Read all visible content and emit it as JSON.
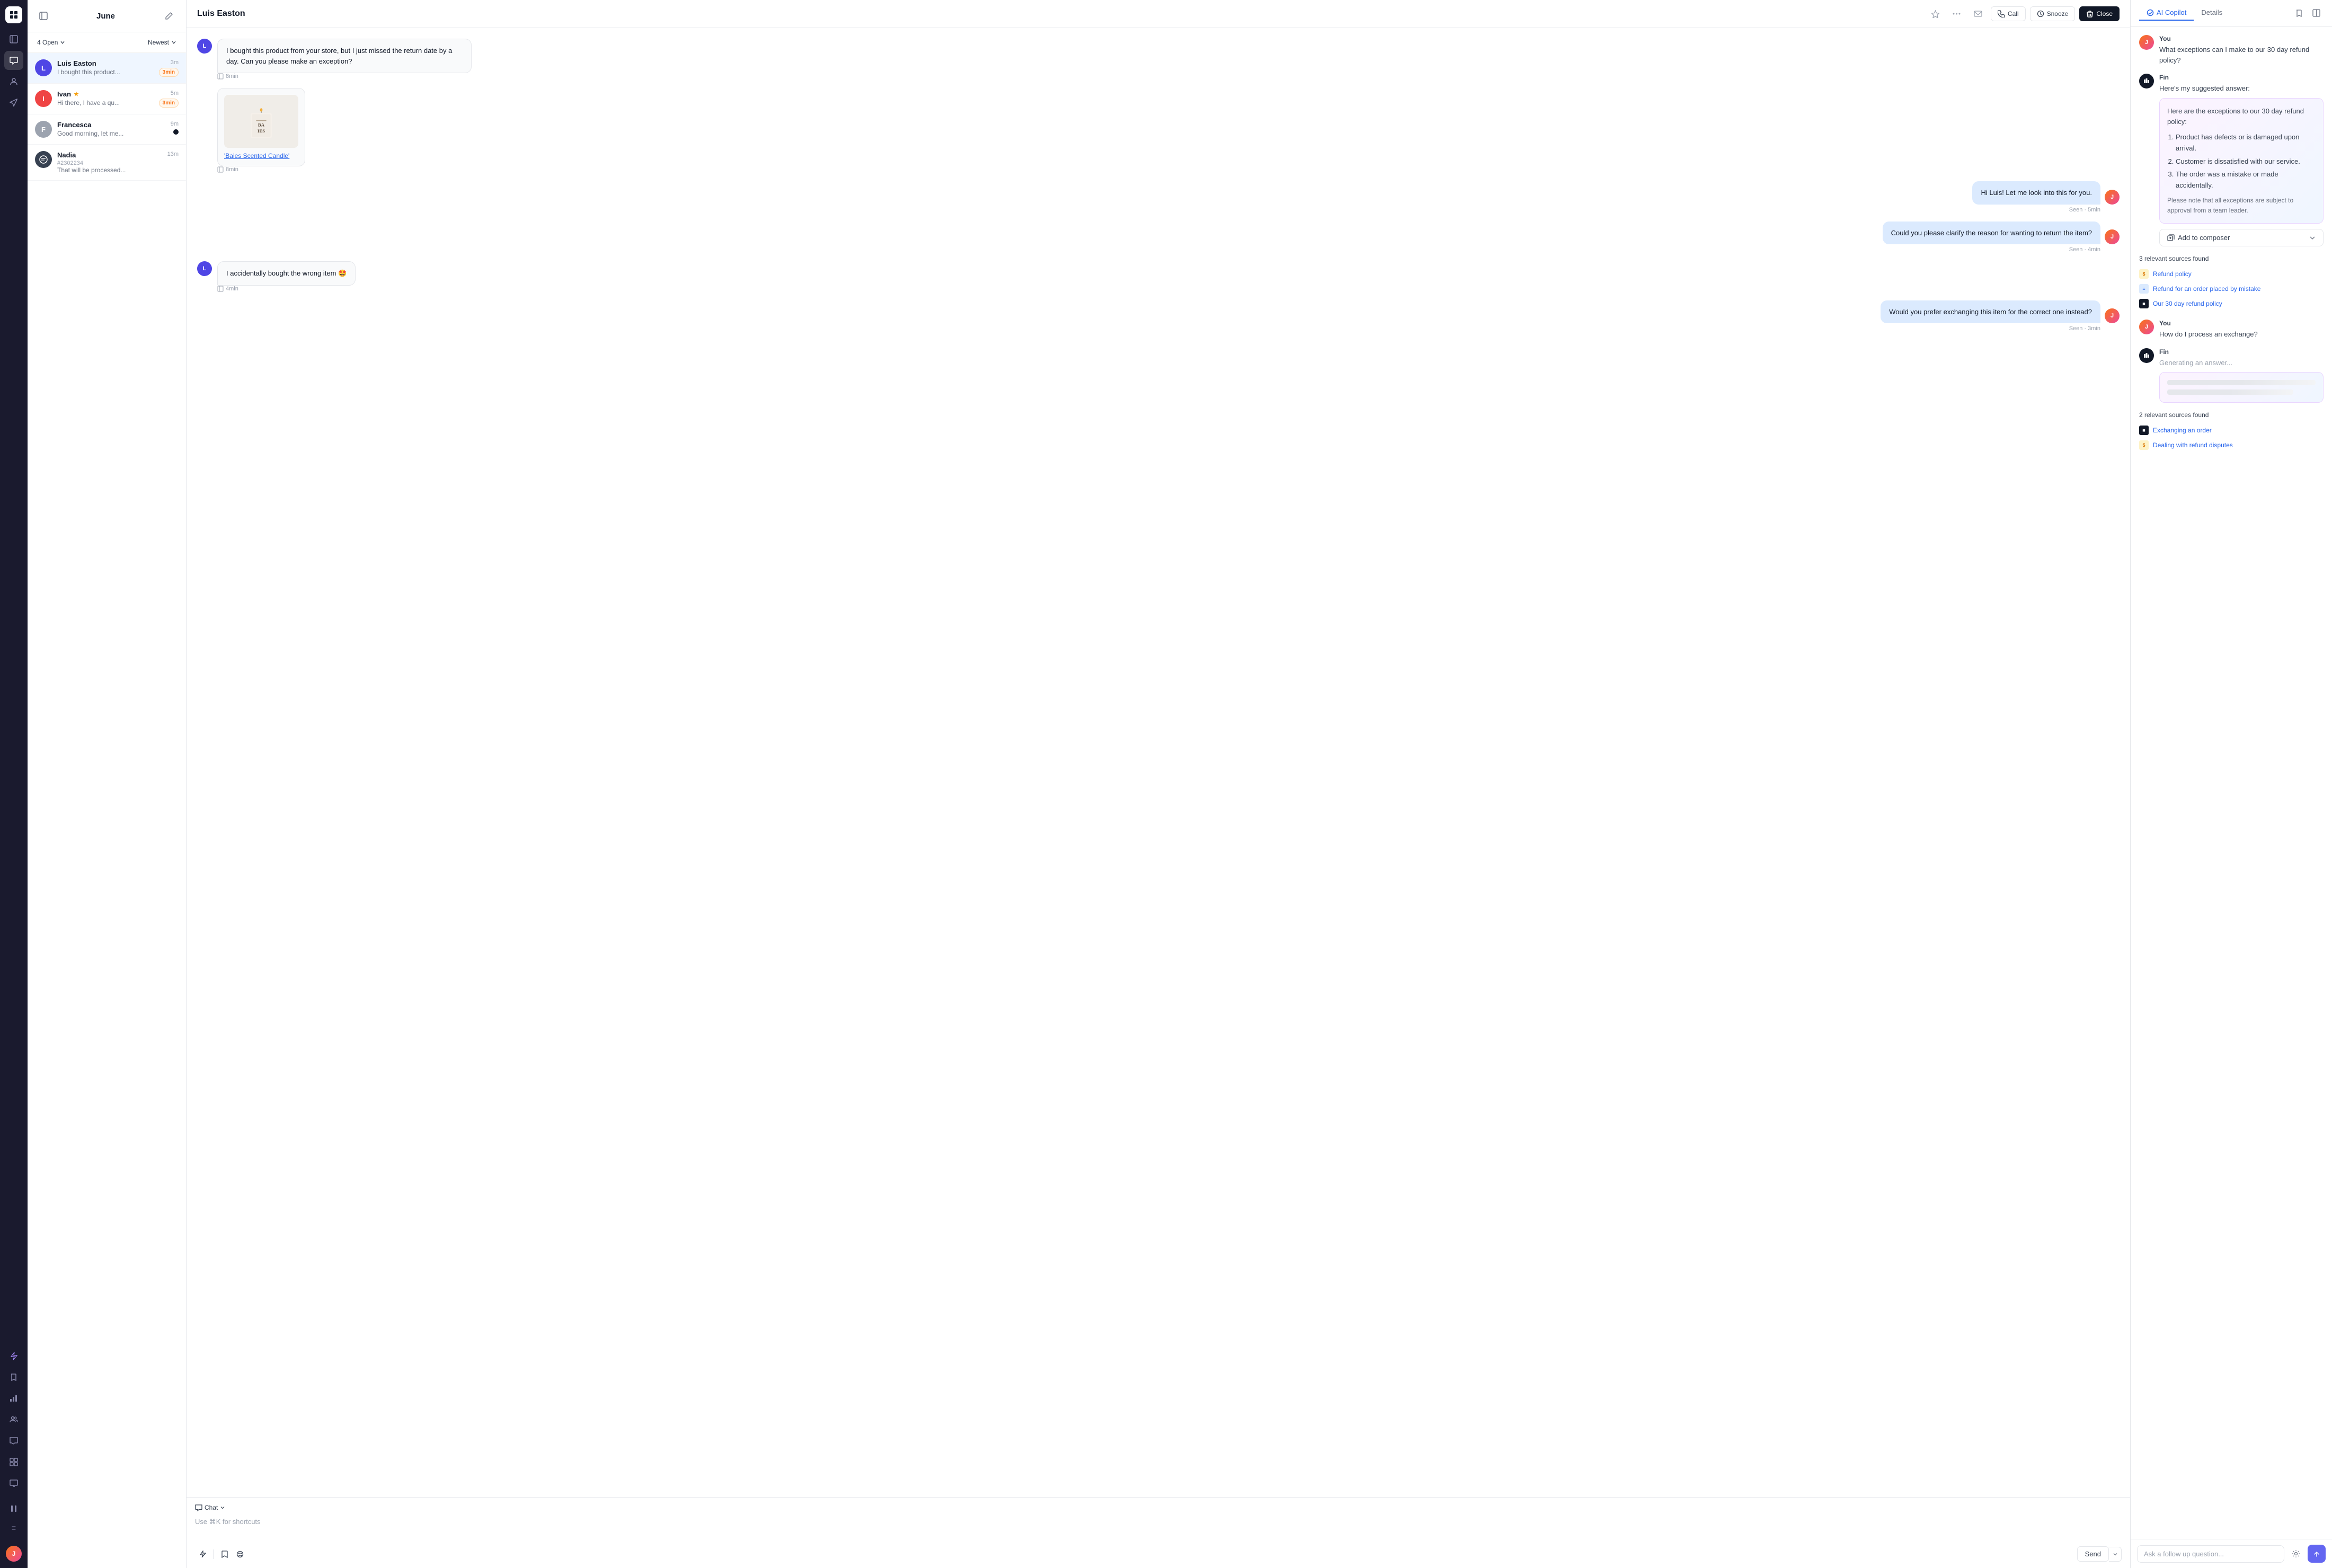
{
  "app": {
    "title": "June",
    "nav_items": [
      {
        "id": "grid",
        "icon": "⊞",
        "active": false
      },
      {
        "id": "inbox",
        "icon": "💬",
        "active": true
      },
      {
        "id": "contacts",
        "icon": "👤",
        "active": false
      },
      {
        "id": "nav4",
        "icon": "🚀",
        "active": false
      },
      {
        "id": "bolt",
        "icon": "⚡",
        "active": false
      },
      {
        "id": "book",
        "icon": "📚",
        "active": false
      },
      {
        "id": "chart",
        "icon": "📊",
        "active": false
      },
      {
        "id": "users",
        "icon": "👥",
        "active": false
      },
      {
        "id": "messages",
        "icon": "💭",
        "active": false
      },
      {
        "id": "grid2",
        "icon": "🔲",
        "active": false
      },
      {
        "id": "monitor",
        "icon": "🖥",
        "active": false
      }
    ],
    "user_avatar_initials": "J"
  },
  "conversations": {
    "filter_label": "4 Open",
    "sort_label": "Newest",
    "items": [
      {
        "id": "luis",
        "name": "Luis Easton",
        "preview": "I bought this product...",
        "time": "3m",
        "avatar_color": "#4f46e5",
        "avatar_initial": "L",
        "badge": "3min",
        "badge_type": "timer",
        "active": true
      },
      {
        "id": "ivan",
        "name": "Ivan",
        "preview": "Hi there, I have a qu...",
        "time": "5m",
        "avatar_color": "#ef4444",
        "avatar_initial": "I",
        "badge": "3min",
        "badge_type": "timer",
        "has_star": true,
        "active": false
      },
      {
        "id": "francesca",
        "name": "Francesca",
        "preview": "Good morning, let me...",
        "time": "9m",
        "avatar_color": "#6b7280",
        "avatar_initial": "F",
        "has_dark_badge": true,
        "active": false
      },
      {
        "id": "nadia",
        "name": "Nadia",
        "preview": "#2302234\nThat will be processed...",
        "preview_line1": "#2302234",
        "preview_line2": "That will be processed...",
        "time": "13m",
        "avatar_color": "#374151",
        "avatar_initial": "N",
        "avatar_icon": "💬",
        "active": false
      }
    ]
  },
  "chat": {
    "user_name": "Luis Easton",
    "messages": [
      {
        "id": "m1",
        "type": "incoming",
        "text": "I bought this product from your store, but I just missed the return date by a day. Can you please make an exception?",
        "time": "8min"
      },
      {
        "id": "m2",
        "type": "product_card",
        "product_name": "'Baies Scented Candle'",
        "time": "8min"
      },
      {
        "id": "m3",
        "type": "outgoing",
        "text": "Hi Luis! Let me look into this for you.",
        "time": "5min",
        "status": "Seen"
      },
      {
        "id": "m4",
        "type": "outgoing",
        "text": "Could you please clarify the reason for wanting to return the item?",
        "time": "4min",
        "status": "Seen"
      },
      {
        "id": "m5",
        "type": "incoming",
        "text": "I accidentally bought the wrong item 🤩",
        "time": "4min"
      },
      {
        "id": "m6",
        "type": "outgoing",
        "text": "Would you prefer exchanging this item for the correct one instead?",
        "time": "3min",
        "status": "Seen"
      }
    ],
    "composer": {
      "type_label": "Chat",
      "type_icon": "💬",
      "placeholder": "Use ⌘K for shortcuts",
      "send_label": "Send"
    }
  },
  "ai_panel": {
    "tab_active": "AI Copilot",
    "tabs": [
      {
        "id": "copilot",
        "label": "AI Copilot"
      },
      {
        "id": "details",
        "label": "Details"
      }
    ],
    "conversation": [
      {
        "id": "ai1",
        "sender": "You",
        "sender_type": "user",
        "text": "What exceptions can I make to our 30 day refund policy?"
      },
      {
        "id": "ai2",
        "sender": "Fin",
        "sender_type": "fin",
        "intro": "Here's my suggested answer:",
        "suggestion": {
          "intro": "Here are the exceptions to our 30 day refund policy:",
          "list": [
            "Product has defects or is damaged upon arrival.",
            "Customer is dissatisfied with our service.",
            "The order was a mistake or made accidentally."
          ],
          "note": "Please note that all exceptions are subject to approval from a team leader."
        },
        "add_to_composer_label": "Add to composer"
      },
      {
        "id": "sources1",
        "type": "sources",
        "count": "3 relevant sources found",
        "items": [
          {
            "label": "Refund policy",
            "icon_type": "yellow"
          },
          {
            "label": "Refund for an order placed by mistake",
            "icon_type": "blue"
          },
          {
            "label": "Our 30 day refund policy",
            "icon_type": "dark"
          }
        ]
      },
      {
        "id": "ai3",
        "sender": "You",
        "sender_type": "user",
        "text": "How do I process an exchange?"
      },
      {
        "id": "ai4",
        "sender": "Fin",
        "sender_type": "fin",
        "intro": "Generating an answer...",
        "is_generating": true
      },
      {
        "id": "sources2",
        "type": "sources",
        "count": "2 relevant sources found",
        "items": [
          {
            "label": "Exchanging an order",
            "icon_type": "dark"
          },
          {
            "label": "Dealing with refund disputes",
            "icon_type": "yellow"
          }
        ]
      }
    ],
    "followup_placeholder": "Ask a follow up question..."
  }
}
